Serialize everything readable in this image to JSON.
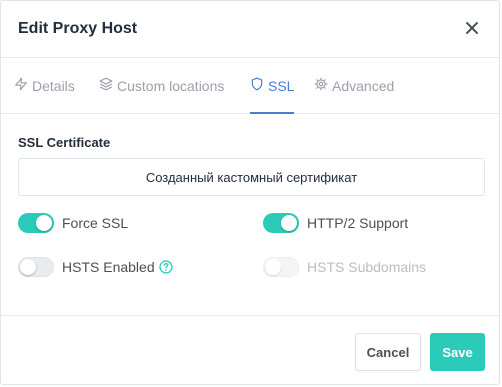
{
  "modal": {
    "title": "Edit Proxy Host"
  },
  "tabs": [
    {
      "label": "Details",
      "icon": "bolt-icon"
    },
    {
      "label": "Custom locations",
      "icon": "layers-icon"
    },
    {
      "label": "SSL",
      "icon": "shield-icon",
      "active": true
    },
    {
      "label": "Advanced",
      "icon": "gear-icon"
    }
  ],
  "ssl": {
    "certificate_label": "SSL Certificate",
    "certificate_value": "Созданный кастомный сертификат",
    "toggles": {
      "force_ssl": {
        "label": "Force SSL",
        "state": "on"
      },
      "http2": {
        "label": "HTTP/2 Support",
        "state": "on"
      },
      "hsts": {
        "label": "HSTS Enabled",
        "state": "off"
      },
      "hsts_subdomains": {
        "label": "HSTS Subdomains",
        "state": "disabled"
      }
    }
  },
  "footer": {
    "cancel_label": "Cancel",
    "save_label": "Save"
  },
  "colors": {
    "accent": "#467fcf",
    "toggle_on": "#2bcbba",
    "save_button": "#2bcbba"
  }
}
